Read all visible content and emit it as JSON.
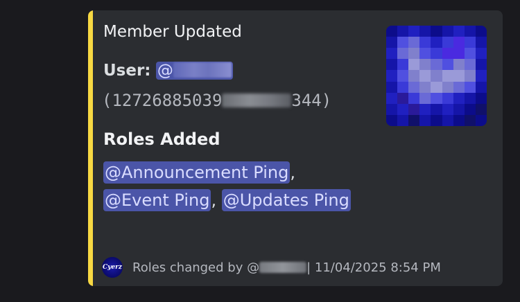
{
  "embed": {
    "accent_color": "#f7d843",
    "title": "Member Updated",
    "user_label": "User:",
    "user_mention_prefix": "@",
    "user_id_prefix": "(12726885039",
    "user_id_suffix": "344)",
    "roles_title": "Roles Added",
    "roles": [
      {
        "name": "@Announcement Ping",
        "sep": ","
      },
      {
        "name": "@Event Ping",
        "sep": ","
      },
      {
        "name": "@Updates Ping",
        "sep": ""
      }
    ],
    "thumbnail_icon": "pixelated-avatar",
    "footer": {
      "icon_text": "Cyerz",
      "text_prefix": "Roles changed by @",
      "text_suffix": "| 11/04/2025 8:54 PM"
    }
  }
}
